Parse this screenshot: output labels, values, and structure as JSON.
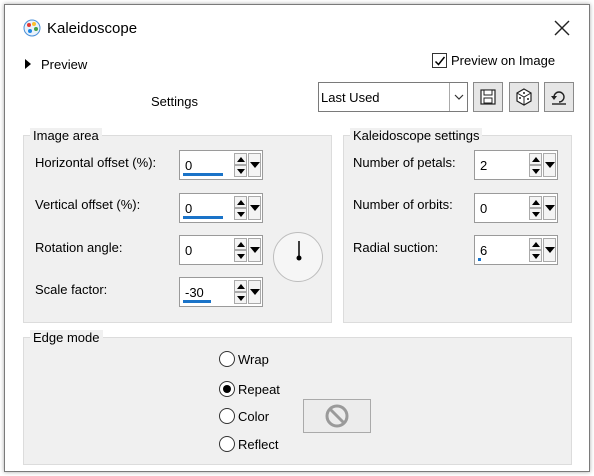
{
  "window": {
    "title": "Kaleidoscope"
  },
  "preview": {
    "label": "Preview",
    "preview_on_image_label": "Preview on Image",
    "preview_on_image_checked": true
  },
  "settings": {
    "label": "Settings",
    "preset": "Last Used"
  },
  "image_area": {
    "label": "Image area",
    "horizontal_offset": {
      "label": "Horizontal offset (%):",
      "value": "0"
    },
    "vertical_offset": {
      "label": "Vertical offset (%):",
      "value": "0"
    },
    "rotation_angle": {
      "label": "Rotation angle:",
      "value": "0"
    },
    "scale_factor": {
      "label": "Scale factor:",
      "value": "-30"
    }
  },
  "kaleidoscope_settings": {
    "label": "Kaleidoscope settings",
    "number_of_petals": {
      "label": "Number of petals:",
      "value": "2"
    },
    "number_of_orbits": {
      "label": "Number of orbits:",
      "value": "0"
    },
    "radial_suction": {
      "label": "Radial suction:",
      "value": "6"
    }
  },
  "edge_mode": {
    "label": "Edge mode",
    "options": [
      "Wrap",
      "Repeat",
      "Color",
      "Reflect"
    ],
    "selected": "Repeat"
  },
  "colors": {
    "accent": "#1a73c8",
    "panel_bg": "#f0f0f0"
  }
}
